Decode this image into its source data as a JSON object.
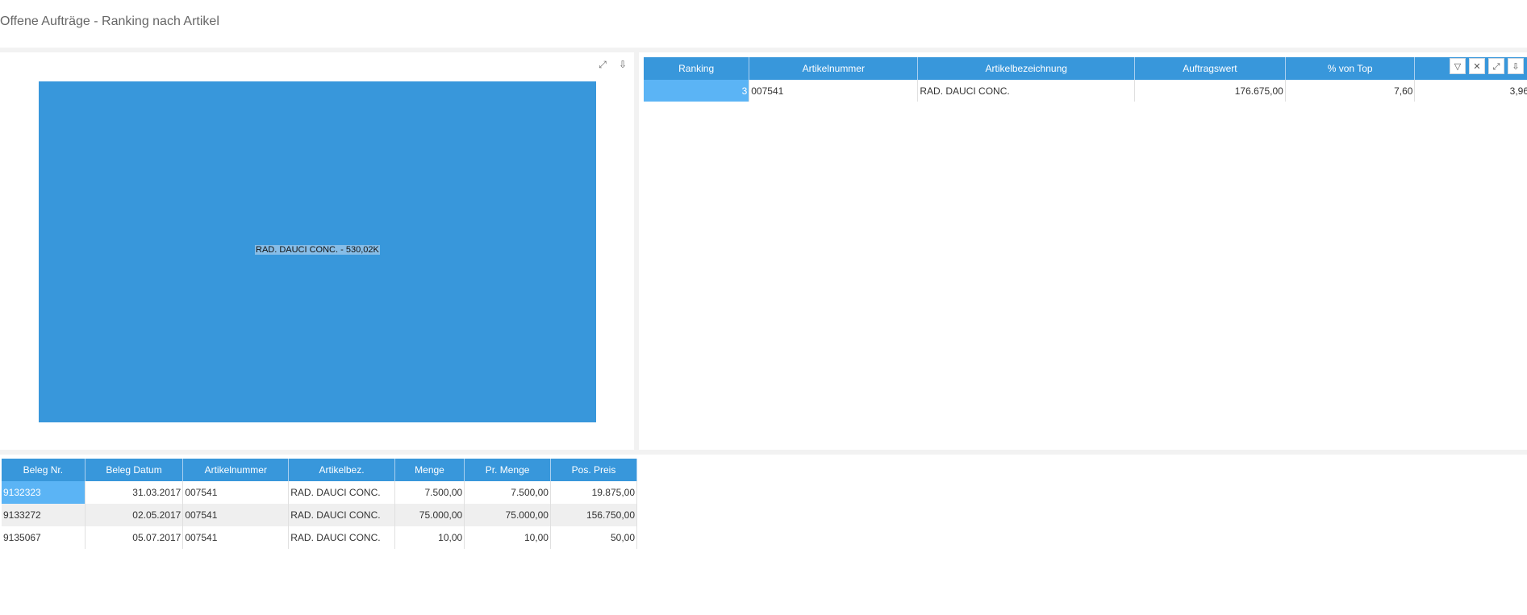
{
  "page": {
    "title": "Offene Aufträge - Ranking nach Artikel"
  },
  "treemap": {
    "label": "RAD. DAUCI CONC. - 530,02K",
    "color": "#3897db",
    "tools": {
      "expand_icon": "expand-icon",
      "export_icon": "export-icon"
    }
  },
  "ranking_table": {
    "columns": [
      "Ranking",
      "Artikelnummer",
      "Artikelbezeichnung",
      "Auftragswert",
      "% von Top",
      ""
    ],
    "rows": [
      {
        "ranking": "3",
        "artikelnummer": "007541",
        "bezeichnung": "RAD. DAUCI CONC.",
        "auftragswert": "176.675,00",
        "pct_top": "7,60",
        "extra": "3,96"
      }
    ]
  },
  "detail_table": {
    "columns": [
      "Beleg Nr.",
      "Beleg Datum",
      "Artikelnummer",
      "Artikelbez.",
      "Menge",
      "Pr. Menge",
      "Pos. Preis"
    ],
    "rows": [
      {
        "beleg_nr": "9132323",
        "datum": "31.03.2017",
        "artikelnummer": "007541",
        "bez": "RAD. DAUCI CONC.",
        "menge": "7.500,00",
        "pr_menge": "7.500,00",
        "preis": "19.875,00"
      },
      {
        "beleg_nr": "9133272",
        "datum": "02.05.2017",
        "artikelnummer": "007541",
        "bez": "RAD. DAUCI CONC.",
        "menge": "75.000,00",
        "pr_menge": "75.000,00",
        "preis": "156.750,00"
      },
      {
        "beleg_nr": "9135067",
        "datum": "05.07.2017",
        "artikelnummer": "007541",
        "bez": "RAD. DAUCI CONC.",
        "menge": "10,00",
        "pr_menge": "10,00",
        "preis": "50,00"
      }
    ]
  }
}
